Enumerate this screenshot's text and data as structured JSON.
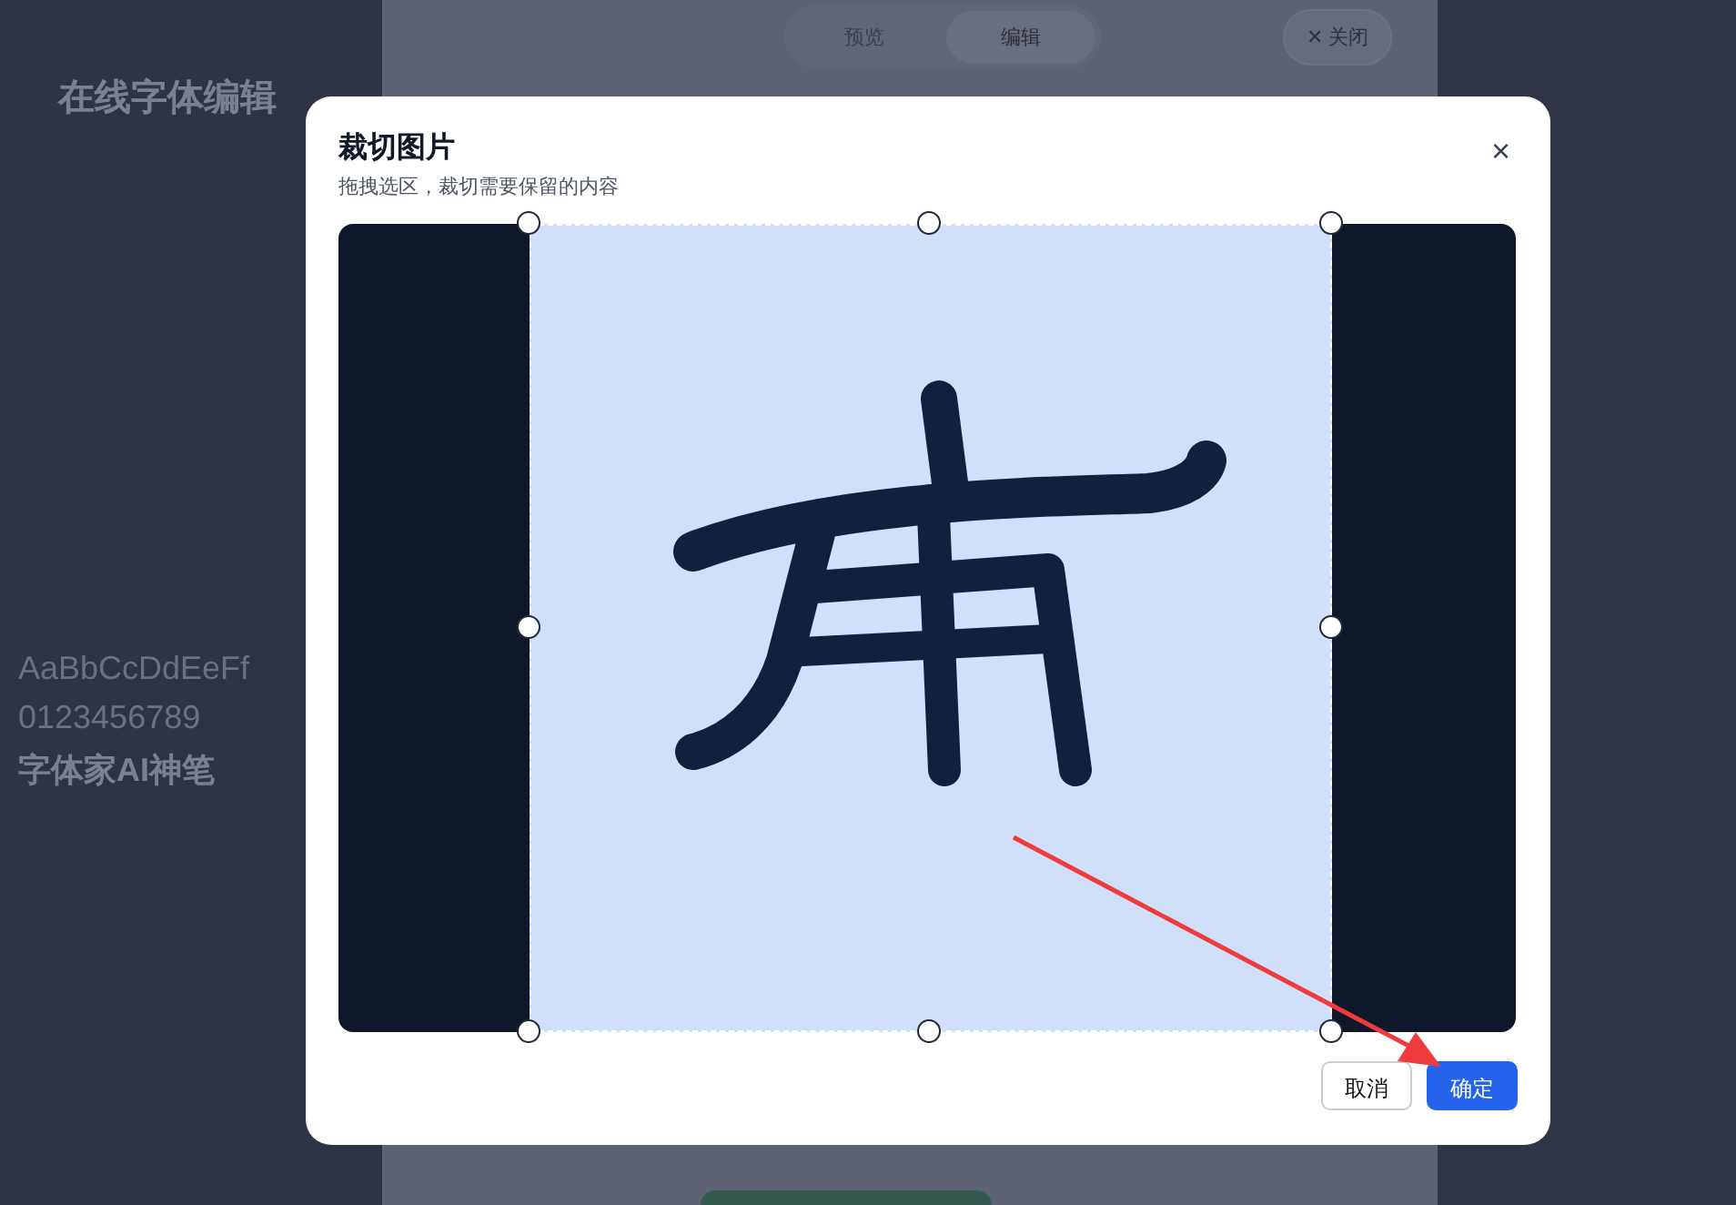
{
  "backdrop": {
    "app_title": "在线字体编辑",
    "samples": [
      "AaBbCcDdEeFf",
      "0123456789",
      "字体家AI神笔"
    ],
    "tabs": [
      {
        "label": "预览",
        "selected": false
      },
      {
        "label": "编辑",
        "selected": true
      }
    ],
    "close_button": "✕ 关闭"
  },
  "dialog": {
    "title": "裁切图片",
    "subtitle": "拖拽选区，裁切需要保留的内容",
    "close": "×",
    "buttons": [
      {
        "label": "取消",
        "kind": "secondary"
      },
      {
        "label": "确定",
        "kind": "primary"
      }
    ]
  }
}
